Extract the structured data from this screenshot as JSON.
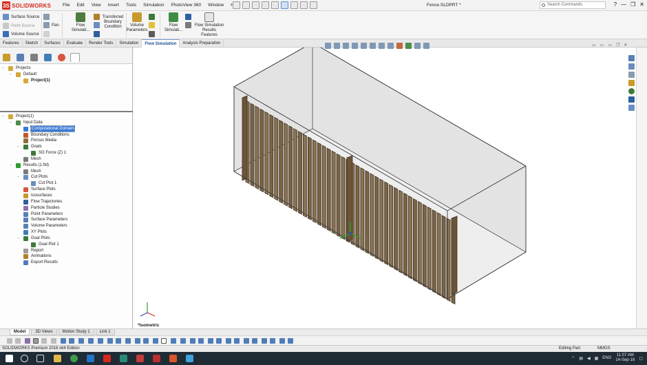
{
  "app": {
    "logo_text": "SOLIDWORKS",
    "document_title": "Fence.SLDPRT *",
    "search_placeholder": "Search Commands",
    "window_controls": [
      "?",
      "—",
      "❐",
      "✕"
    ]
  },
  "menu": [
    "File",
    "Edit",
    "View",
    "Insert",
    "Tools",
    "Simulation",
    "PhotoView 360",
    "Window",
    "Help"
  ],
  "command_manager": {
    "surface_source": "Surface Source",
    "point_source": "Point Source",
    "volume_source": "Volume Source",
    "pan": "Pan",
    "flow_simulation": "Flow Simulati...",
    "transferred_bc_1": "Transferred",
    "transferred_bc_2": "Boundary",
    "transferred_bc_3": "Condition",
    "volume_parameters_1": "Volume",
    "volume_parameters_2": "Parameters",
    "flow_simulation_2": "Flow Simulati...",
    "flow_results_features_1": "Flow Simulation",
    "flow_results_features_2": "Results Features"
  },
  "tabs": [
    {
      "label": "Features",
      "active": false
    },
    {
      "label": "Sketch",
      "active": false
    },
    {
      "label": "Surfaces",
      "active": false
    },
    {
      "label": "Evaluate",
      "active": false
    },
    {
      "label": "Render Tools",
      "active": false
    },
    {
      "label": "Simulation",
      "active": false
    },
    {
      "label": "Flow Simulation",
      "active": true
    },
    {
      "label": "Analysis Preparation",
      "active": false
    }
  ],
  "projects_tree": [
    {
      "label": "Projects",
      "level": 0,
      "expander": "−",
      "icon": "folder"
    },
    {
      "label": "Default",
      "level": 1,
      "expander": "−",
      "icon": "folder"
    },
    {
      "label": "Project(1)",
      "level": 2,
      "expander": "",
      "icon": "folder",
      "bold": true
    }
  ],
  "analysis_tree": [
    {
      "label": "Project(1)",
      "level": 0,
      "expander": "−",
      "icon": "folder"
    },
    {
      "label": "Input Data",
      "level": 1,
      "expander": "−",
      "icon": "data"
    },
    {
      "label": "Computational Domain",
      "level": 2,
      "expander": "",
      "icon": "domain",
      "selected": true
    },
    {
      "label": "Boundary Conditions",
      "level": 2,
      "expander": "",
      "icon": "bc"
    },
    {
      "label": "Porous Media",
      "level": 2,
      "expander": "",
      "icon": "porous"
    },
    {
      "label": "Goals",
      "level": 2,
      "expander": "−",
      "icon": "goal"
    },
    {
      "label": "SG Force (Z) 1",
      "level": 3,
      "expander": "",
      "icon": "goal"
    },
    {
      "label": "Mesh",
      "level": 2,
      "expander": "",
      "icon": "mesh"
    },
    {
      "label": "Results (1.fld)",
      "level": 1,
      "expander": "−",
      "icon": "results"
    },
    {
      "label": "Mesh",
      "level": 2,
      "expander": "",
      "icon": "mesh"
    },
    {
      "label": "Cut Plots",
      "level": 2,
      "expander": "−",
      "icon": "cut"
    },
    {
      "label": "Cut Plot 1",
      "level": 3,
      "expander": "",
      "icon": "cut"
    },
    {
      "label": "Surface Plots",
      "level": 2,
      "expander": "",
      "icon": "surface"
    },
    {
      "label": "Isosurfaces",
      "level": 2,
      "expander": "",
      "icon": "iso"
    },
    {
      "label": "Flow Trajectories",
      "level": 2,
      "expander": "",
      "icon": "traj"
    },
    {
      "label": "Particle Studies",
      "level": 2,
      "expander": "",
      "icon": "particle"
    },
    {
      "label": "Point Parameters",
      "level": 2,
      "expander": "",
      "icon": "param"
    },
    {
      "label": "Surface Parameters",
      "level": 2,
      "expander": "",
      "icon": "param"
    },
    {
      "label": "Volume Parameters",
      "level": 2,
      "expander": "",
      "icon": "param"
    },
    {
      "label": "XY Plots",
      "level": 2,
      "expander": "",
      "icon": "xy"
    },
    {
      "label": "Goal Plots",
      "level": 2,
      "expander": "−",
      "icon": "goal"
    },
    {
      "label": "Goal Plot 1",
      "level": 3,
      "expander": "",
      "icon": "goal"
    },
    {
      "label": "Report",
      "level": 2,
      "expander": "",
      "icon": "report"
    },
    {
      "label": "Animations",
      "level": 2,
      "expander": "",
      "icon": "anim"
    },
    {
      "label": "Export Results",
      "level": 2,
      "expander": "",
      "icon": "export"
    }
  ],
  "viewport": {
    "view_label": "*Isometric",
    "fence_color": "#7a6446",
    "domain_color": "#e3e3e3"
  },
  "bottom_tabs": [
    {
      "label": "Model",
      "active": true
    },
    {
      "label": "3D Views",
      "active": false
    },
    {
      "label": "Motion Study 1",
      "active": false
    },
    {
      "label": "Link 1",
      "active": false
    }
  ],
  "status": {
    "edition": "SOLIDWORKS Premium 2016 x64 Edition",
    "mode": "Editing Part",
    "units": "MMGS"
  },
  "taskbar": {
    "language": "ENG",
    "time": "11:07 AM",
    "date": "14-Sep-16"
  },
  "colors": {
    "brand": "#d52b1e",
    "accent": "#3a7bd5",
    "taskbar": "#1f2b35"
  }
}
